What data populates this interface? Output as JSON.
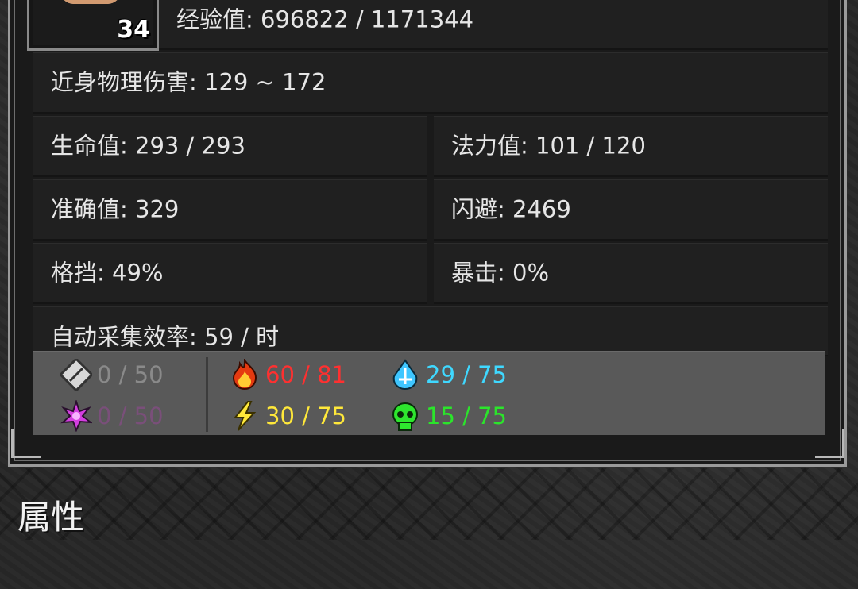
{
  "hero": {
    "level": "34",
    "exp_label": "经验值: 696822 / 1171344"
  },
  "stats": {
    "melee": "近身物理伤害: 129 ~ 172",
    "hp": "生命值: 293 / 293",
    "mp": "法力值: 101 / 120",
    "accuracy": "准确值: 329",
    "dodge": "闪避: 2469",
    "block": "格挡: 49%",
    "crit": "暴击: 0%",
    "gather": "自动采集效率: 59 / 时"
  },
  "resistances": [
    {
      "icon": "physical-resist-icon",
      "value": "0 / 50",
      "color": "#8a8a8a"
    },
    {
      "icon": "arcane-resist-icon",
      "value": "0 / 50",
      "color": "#7a4f7a"
    },
    {
      "icon": "fire-resist-icon",
      "value": "60 / 81",
      "color": "#ff3030"
    },
    {
      "icon": "lightning-resist-icon",
      "value": "30 / 75",
      "color": "#ffe83a"
    },
    {
      "icon": "cold-resist-icon",
      "value": "29 / 75",
      "color": "#3fd8ff"
    },
    {
      "icon": "poison-resist-icon",
      "value": "15 / 75",
      "color": "#2be52b"
    }
  ],
  "section_title": "属性"
}
